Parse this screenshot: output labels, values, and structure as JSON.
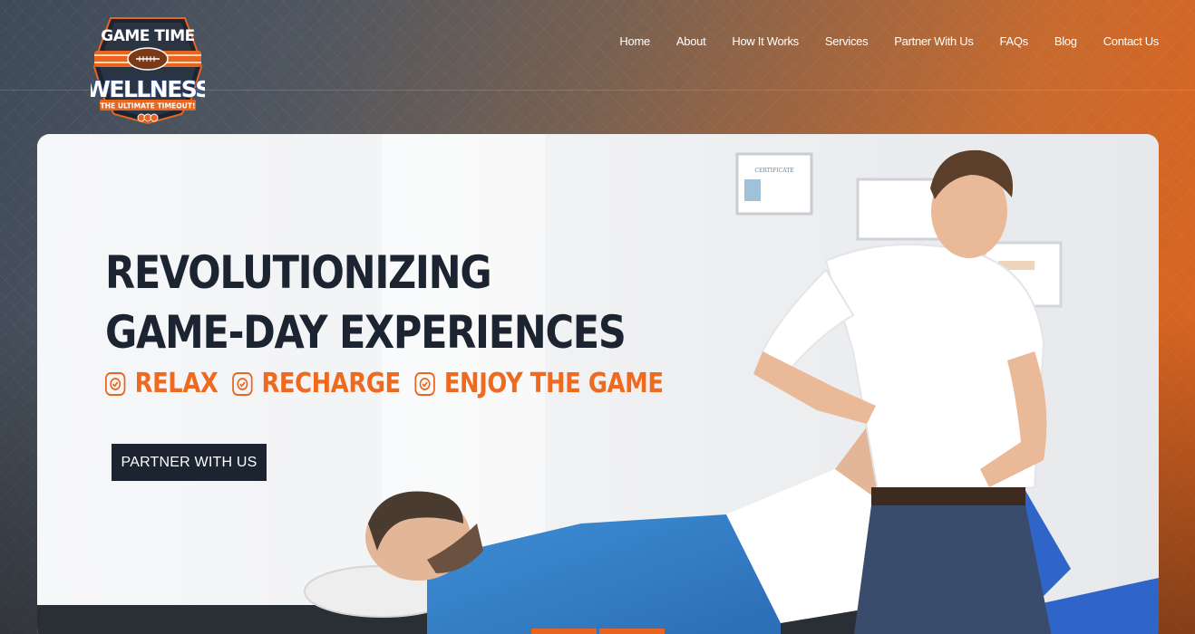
{
  "logo": {
    "top_text": "GAME TIME",
    "main_text": "WELLNESS",
    "sub_text": "THE ULTIMATE TIMEOUT!"
  },
  "nav": {
    "items": [
      "Home",
      "About",
      "How It Works",
      "Services",
      "Partner With Us",
      "FAQs",
      "Blog",
      "Contact Us"
    ]
  },
  "hero": {
    "title_line1": "REVOLUTIONIZING",
    "title_line2": "GAME-DAY EXPERIENCES",
    "taglines": [
      "RELAX",
      "RECHARGE",
      "ENJOY THE GAME"
    ],
    "cta_label": "PARTNER WITH US",
    "certificate_text": "CERTIFICATE"
  },
  "colors": {
    "accent": "#ef6a1f",
    "dark": "#1b2430",
    "logo_blue": "#2f4a8a"
  },
  "icons": [
    "football-icon",
    "check-icon"
  ]
}
